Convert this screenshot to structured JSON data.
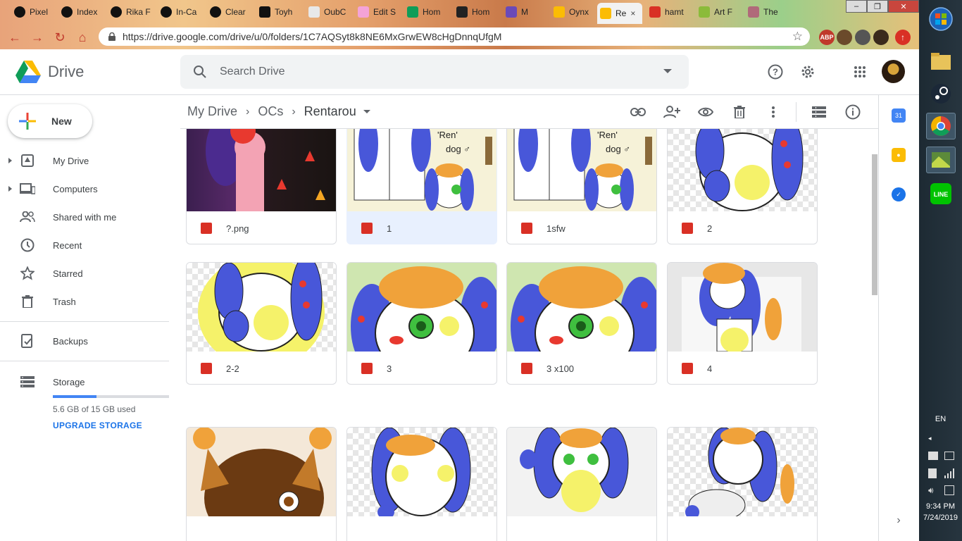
{
  "browser": {
    "tabs": [
      {
        "title": "Pixel",
        "icon": "paw-icon"
      },
      {
        "title": "Index",
        "icon": "paw-icon"
      },
      {
        "title": "Rika F",
        "icon": "paw-icon"
      },
      {
        "title": "In-Ca",
        "icon": "paw-icon"
      },
      {
        "title": "Clear",
        "icon": "paw-icon"
      },
      {
        "title": "Toyh",
        "icon": "th-icon"
      },
      {
        "title": "OubC",
        "icon": "board-icon"
      },
      {
        "title": "Edit S",
        "icon": "k-icon"
      },
      {
        "title": "Hom",
        "icon": "sheet-icon"
      },
      {
        "title": "Hom",
        "icon": "dark-icon"
      },
      {
        "title": "M",
        "icon": "puzzle-icon"
      },
      {
        "title": "Oynx",
        "icon": "drive-icon"
      },
      {
        "title": "Re",
        "icon": "drive-icon",
        "active": true
      },
      {
        "title": "hamt",
        "icon": "globe-icon"
      },
      {
        "title": "Art F",
        "icon": "sun-icon"
      },
      {
        "title": "The",
        "icon": "tabletop-icon"
      }
    ],
    "close_glyph": "×",
    "url": "https://drive.google.com/drive/u/0/folders/1C7AQSyt8k8NE6MxGrwEW8cHgDnnqUfgM",
    "ext_abp": "ABP"
  },
  "drive": {
    "app_name": "Drive",
    "search_placeholder": "Search Drive",
    "new_label": "New",
    "nav": [
      {
        "label": "My Drive",
        "icon": "my-drive-icon",
        "expandable": true
      },
      {
        "label": "Computers",
        "icon": "computers-icon",
        "expandable": true
      },
      {
        "label": "Shared with me",
        "icon": "shared-icon",
        "expandable": false
      },
      {
        "label": "Recent",
        "icon": "recent-icon",
        "expandable": false
      },
      {
        "label": "Starred",
        "icon": "star-icon",
        "expandable": false
      },
      {
        "label": "Trash",
        "icon": "trash-icon",
        "expandable": false
      }
    ],
    "backups_label": "Backups",
    "storage_label": "Storage",
    "storage_used": "5.6 GB of 15 GB used",
    "storage_fraction": 0.373,
    "upgrade_label": "UPGRADE STORAGE",
    "breadcrumb": [
      "My Drive",
      "OCs",
      "Rentarou"
    ],
    "files": [
      {
        "name": "?.png",
        "selected": false
      },
      {
        "name": "1",
        "selected": true
      },
      {
        "name": "1sfw",
        "selected": false
      },
      {
        "name": "2",
        "selected": false
      },
      {
        "name": "2-2",
        "selected": false
      },
      {
        "name": "3",
        "selected": false
      },
      {
        "name": "3 x100",
        "selected": false
      },
      {
        "name": "4",
        "selected": false
      },
      {
        "name": "",
        "selected": false
      },
      {
        "name": "",
        "selected": false
      },
      {
        "name": "",
        "selected": false
      },
      {
        "name": "",
        "selected": false
      }
    ],
    "thumb_text": "'Ren'\ndog ♂"
  },
  "taskbar": {
    "lang": "EN",
    "time": "9:34 PM",
    "date": "7/24/2019",
    "line_label": "LINE"
  },
  "colors": {
    "accent": "#1a73e8",
    "file_icon": "#d93025",
    "selected_bg": "#e8f0fe"
  }
}
